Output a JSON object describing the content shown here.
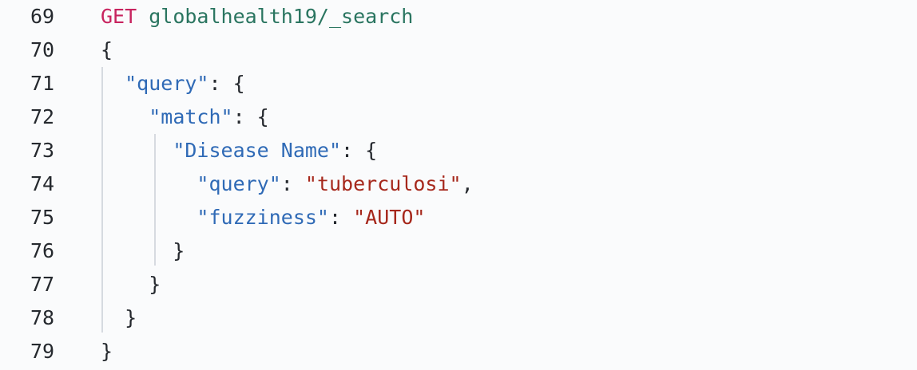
{
  "editor": {
    "lines": [
      {
        "number": "69",
        "tokens": [
          {
            "t": "method",
            "v": "GET"
          },
          {
            "t": "punc",
            "v": " "
          },
          {
            "t": "path",
            "v": "globalhealth19/_search"
          }
        ]
      },
      {
        "number": "70",
        "tokens": [
          {
            "t": "punc",
            "v": "{"
          }
        ]
      },
      {
        "number": "71",
        "tokens": [
          {
            "t": "punc",
            "v": "  "
          },
          {
            "t": "key",
            "v": "\"query\""
          },
          {
            "t": "punc",
            "v": ": {"
          }
        ]
      },
      {
        "number": "72",
        "tokens": [
          {
            "t": "punc",
            "v": "    "
          },
          {
            "t": "key",
            "v": "\"match\""
          },
          {
            "t": "punc",
            "v": ": {"
          }
        ]
      },
      {
        "number": "73",
        "tokens": [
          {
            "t": "punc",
            "v": "      "
          },
          {
            "t": "key",
            "v": "\"Disease Name\""
          },
          {
            "t": "punc",
            "v": ": {"
          }
        ]
      },
      {
        "number": "74",
        "tokens": [
          {
            "t": "punc",
            "v": "        "
          },
          {
            "t": "key",
            "v": "\"query\""
          },
          {
            "t": "punc",
            "v": ": "
          },
          {
            "t": "str",
            "v": "\"tuberculosi\""
          },
          {
            "t": "punc",
            "v": ","
          }
        ]
      },
      {
        "number": "75",
        "tokens": [
          {
            "t": "punc",
            "v": "        "
          },
          {
            "t": "key",
            "v": "\"fuzziness\""
          },
          {
            "t": "punc",
            "v": ": "
          },
          {
            "t": "str",
            "v": "\"AUTO\""
          }
        ]
      },
      {
        "number": "76",
        "tokens": [
          {
            "t": "punc",
            "v": "      }"
          }
        ]
      },
      {
        "number": "77",
        "tokens": [
          {
            "t": "punc",
            "v": "    }"
          }
        ]
      },
      {
        "number": "78",
        "tokens": [
          {
            "t": "punc",
            "v": "  }"
          }
        ]
      },
      {
        "number": "79",
        "tokens": [
          {
            "t": "punc",
            "v": "}"
          }
        ]
      }
    ]
  },
  "colors": {
    "background": "#fafbfc",
    "method": "#c8245f",
    "path": "#2a7560",
    "key": "#2f6ab6",
    "string": "#a6281c",
    "text": "#25292e",
    "indent_guide": "#d6dae0"
  }
}
